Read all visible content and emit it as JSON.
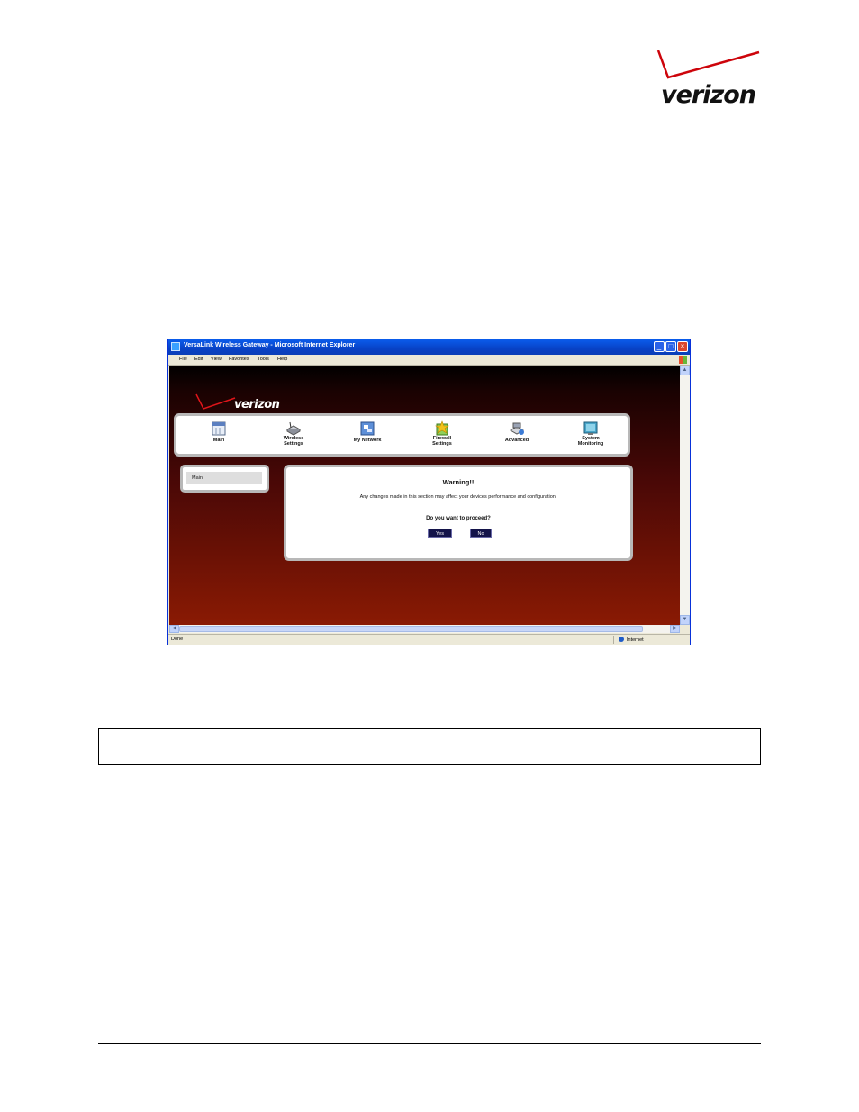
{
  "document": {
    "logo_text": "verizon",
    "brand_colors": {
      "red": "#cd040b",
      "black": "#111111"
    }
  },
  "browser": {
    "title": "VersaLink Wireless Gateway - Microsoft Internet Explorer",
    "window_controls": [
      "minimize-icon",
      "maximize-icon",
      "close-icon"
    ],
    "menu": [
      "File",
      "Edit",
      "View",
      "Favorites",
      "Tools",
      "Help"
    ],
    "status_left": "Done",
    "status_zone": "Internet"
  },
  "page": {
    "logo_text": "verizon",
    "nav": [
      {
        "label": "Main",
        "icon": "calendar-icon"
      },
      {
        "label": "Wireless Settings",
        "icon": "router-icon"
      },
      {
        "label": "My Network",
        "icon": "network-icon"
      },
      {
        "label": "Firewall Settings",
        "icon": "firewall-icon"
      },
      {
        "label": "Advanced",
        "icon": "tools-icon"
      },
      {
        "label": "System Monitoring",
        "icon": "monitor-icon"
      }
    ],
    "side_menu": [
      "Main"
    ],
    "warning": {
      "title": "Warning!!",
      "message": "Any changes made in this section may affect your devices performance and configuration.",
      "question": "Do you want to proceed?",
      "yes_label": "Yes",
      "no_label": "No"
    }
  }
}
